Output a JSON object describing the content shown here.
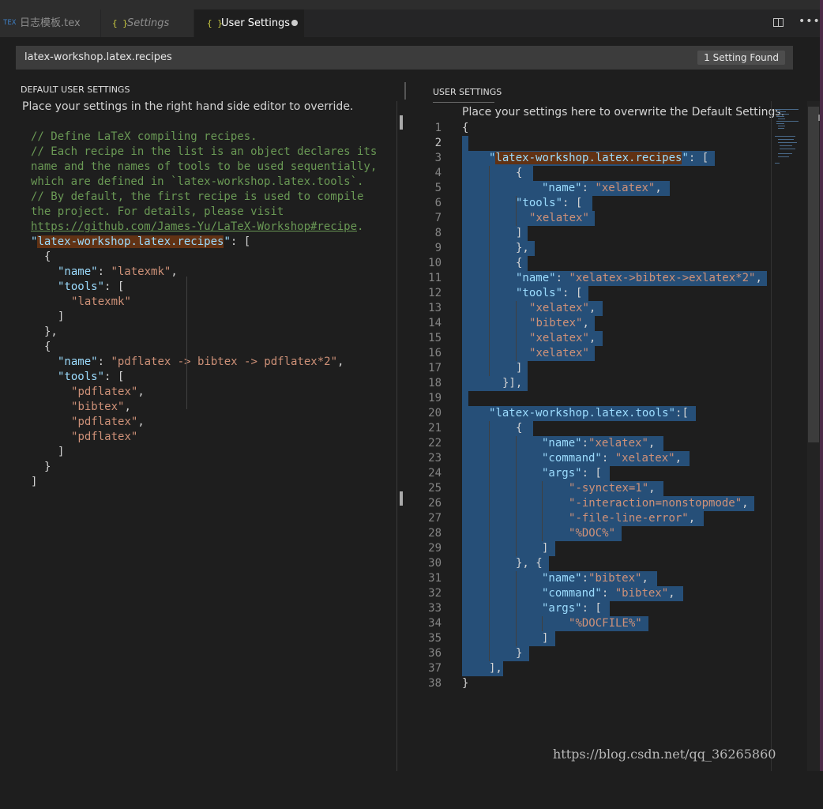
{
  "tabs": [
    {
      "icon": "TEX",
      "label": "日志模板.tex"
    },
    {
      "icon": "{ }",
      "label": "Settings"
    },
    {
      "icon": "{ }",
      "label": "User Settings"
    }
  ],
  "search": {
    "query": "latex-workshop.latex.recipes",
    "result": "1 Setting Found"
  },
  "left": {
    "header": "DEFAULT USER SETTINGS",
    "description": "Place your settings in the right hand side editor to override.",
    "comments": [
      "// Define LaTeX compiling recipes.",
      "// Each recipe in the list is an object declares its",
      "name and the names of tools to be used sequentially,",
      "which are defined in `latex-workshop.latex.tools`.",
      "// By default, the first recipe is used to compile",
      "the project. For details, please visit"
    ],
    "link": "https://github.com/James-Yu/LaTeX-Workshop#recipe",
    "link_end": ".",
    "setting_key": "latex-workshop.latex.recipes",
    "recipe1": {
      "name": "latexmk",
      "tools": [
        "latexmk"
      ]
    },
    "recipe2": {
      "name": "pdflatex -> bibtex -> pdflatex*2",
      "tools": [
        "pdflatex",
        "bibtex",
        "pdflatex",
        "pdflatex"
      ]
    }
  },
  "right": {
    "header": "USER SETTINGS",
    "description": "Place your settings here to overwrite the Default Settings.",
    "recipes_key": "latex-workshop.latex.recipes",
    "tools_key": "latex-workshop.latex.tools",
    "recipeA": {
      "name": "xelatex",
      "tools": [
        "xelatex"
      ]
    },
    "recipeB": {
      "name": "xelatex->bibtex->exlatex*2",
      "tools": [
        "xelatex",
        "bibtex",
        "xelatex",
        "xelatex"
      ]
    },
    "toolA": {
      "name": "xelatex",
      "command": "xelatex",
      "args": [
        "-synctex=1",
        "-interaction=nonstopmode",
        "-file-line-error",
        "%DOC%"
      ]
    },
    "toolB": {
      "name": "bibtex",
      "command": "bibtex",
      "args": [
        "%DOCFILE%"
      ]
    },
    "line_numbers": [
      "1",
      "2",
      "3",
      "4",
      "5",
      "6",
      "7",
      "8",
      "9",
      "10",
      "11",
      "12",
      "13",
      "14",
      "15",
      "16",
      "17",
      "18",
      "19",
      "20",
      "21",
      "22",
      "23",
      "24",
      "25",
      "26",
      "27",
      "28",
      "29",
      "30",
      "31",
      "32",
      "33",
      "34",
      "35",
      "36",
      "37",
      "38"
    ]
  },
  "watermark": "https://blog.csdn.net/qq_36265860",
  "colors": {
    "selection": "#264f78",
    "find_highlight": "#613214",
    "key": "#9cdcfe",
    "string": "#ce9178",
    "comment": "#6a9955"
  }
}
